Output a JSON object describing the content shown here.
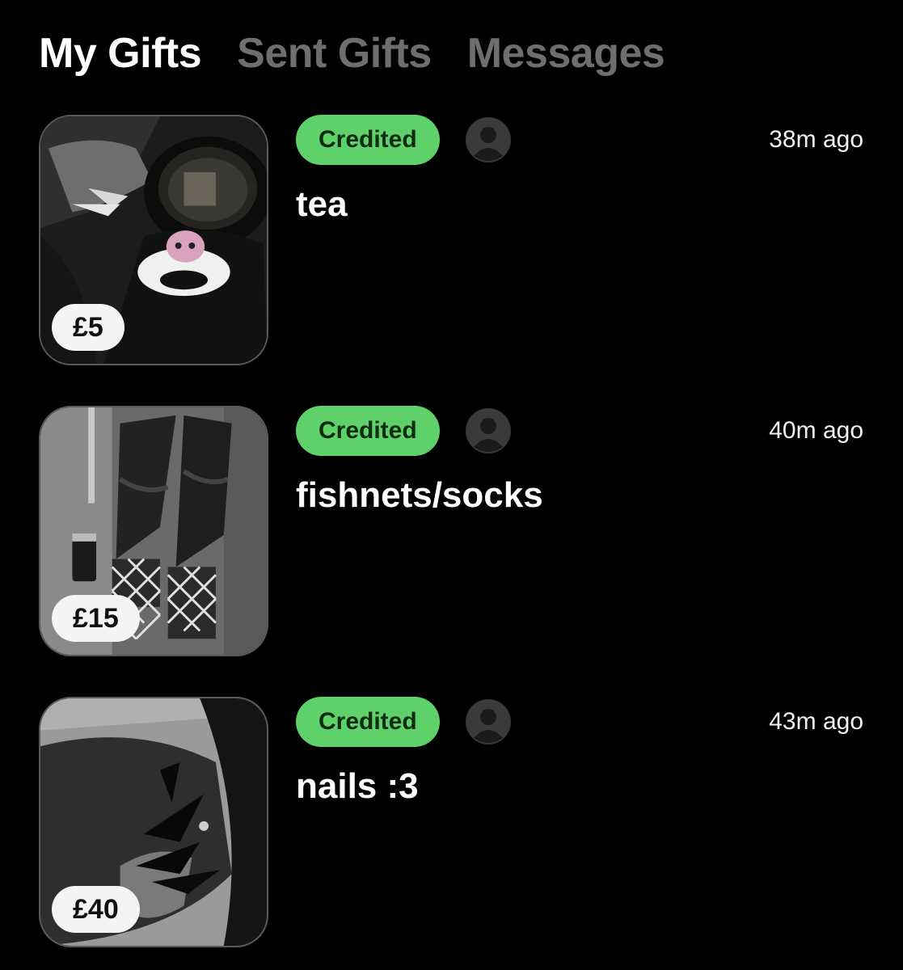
{
  "tabs": [
    {
      "label": "My Gifts",
      "active": true
    },
    {
      "label": "Sent Gifts",
      "active": false
    },
    {
      "label": "Messages",
      "active": false
    }
  ],
  "gifts": [
    {
      "price": "£5",
      "status": "Credited",
      "time": "38m ago",
      "title": "tea",
      "image": "gothic-teapot-photo"
    },
    {
      "price": "£15",
      "status": "Credited",
      "time": "40m ago",
      "title": "fishnets/socks",
      "image": "fishnet-socks-photo"
    },
    {
      "price": "£40",
      "status": "Credited",
      "time": "43m ago",
      "title": "nails :3",
      "image": "black-nails-photo"
    }
  ],
  "colors": {
    "background": "#000000",
    "badge": "#5fd16a",
    "inactive_tab": "#6e6e6e"
  },
  "icons": {
    "avatar": "user-avatar-icon"
  }
}
